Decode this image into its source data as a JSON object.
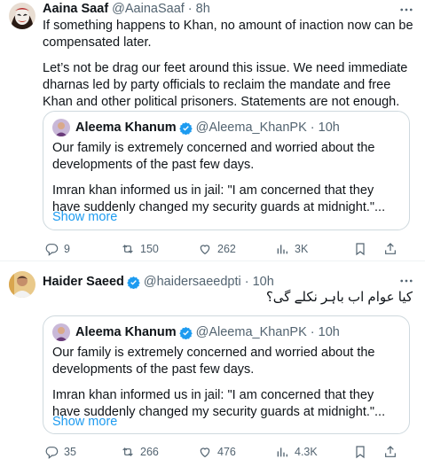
{
  "tweets": [
    {
      "author_name": "Aaina Saaf",
      "author_handle": "@AainaSaaf",
      "time": "8h",
      "paragraphs": [
        "If something happens to Khan, no amount of inaction now can be compensated later.",
        "Let’s not be drag our feet around this issue. We need immediate dharnas led by party officials to reclaim the mandate and free Khan and other political prisoners. Statements are not enough."
      ],
      "quote": {
        "author_name": "Aleema Khanum",
        "author_handle": "@Aleema_KhanPK",
        "time": "10h",
        "paragraphs": [
          "Our family is extremely concerned and worried about the developments of the past few days.",
          "Imran khan informed us in jail: \"I am concerned that they have suddenly changed my security guards at midnight.\"..."
        ],
        "show_more": "Show more"
      },
      "stats": {
        "replies": "9",
        "reposts": "150",
        "likes": "262",
        "views": "3K"
      }
    },
    {
      "author_name": "Haider Saeed",
      "author_handle": "@haidersaeedpti",
      "time": "10h",
      "text": "کیا عوام اب باہر نکلے گی؟",
      "quote": {
        "author_name": "Aleema Khanum",
        "author_handle": "@Aleema_KhanPK",
        "time": "10h",
        "paragraphs": [
          "Our family is extremely concerned and worried about the developments of the past few days.",
          "Imran khan informed us in jail: \"I am concerned that they have suddenly changed my security guards at midnight.\"..."
        ],
        "show_more": "Show more"
      },
      "stats": {
        "replies": "35",
        "reposts": "266",
        "likes": "476",
        "views": "4.3K"
      }
    }
  ],
  "colors": {
    "text": "#0f1419",
    "muted": "#536471",
    "link": "#1d9bf0",
    "verified": "#1d9bf0",
    "border": "#cfd9de"
  },
  "icons": [
    "more-icon",
    "verified-badge-icon",
    "reply-icon",
    "repost-icon",
    "like-icon",
    "views-icon",
    "bookmark-icon",
    "share-icon"
  ]
}
